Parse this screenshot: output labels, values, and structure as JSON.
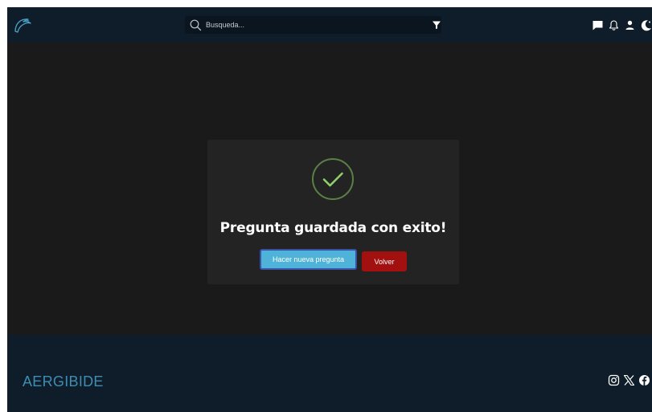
{
  "header": {
    "search": {
      "placeholder": "Busqueda..."
    }
  },
  "modal": {
    "title": "Pregunta guardada con exito!",
    "primary_button": "Hacer nueva pregunta",
    "secondary_button": "Volver"
  },
  "footer": {
    "brand": "AERGIBIDE"
  },
  "icons": [
    "logo-icon",
    "search-icon",
    "filter-icon",
    "chat-icon",
    "bell-icon",
    "user-icon",
    "theme-moon-icon",
    "check-circle-icon",
    "instagram-icon",
    "x-icon",
    "facebook-icon"
  ],
  "colors": {
    "header_bg": "#0e1d29",
    "page_bg": "#1a1a1a",
    "modal_bg": "#232323",
    "accent": "#4fb3d9",
    "danger": "#a31010",
    "success": "#8fcf6a",
    "brand_text": "#3f8db3"
  }
}
